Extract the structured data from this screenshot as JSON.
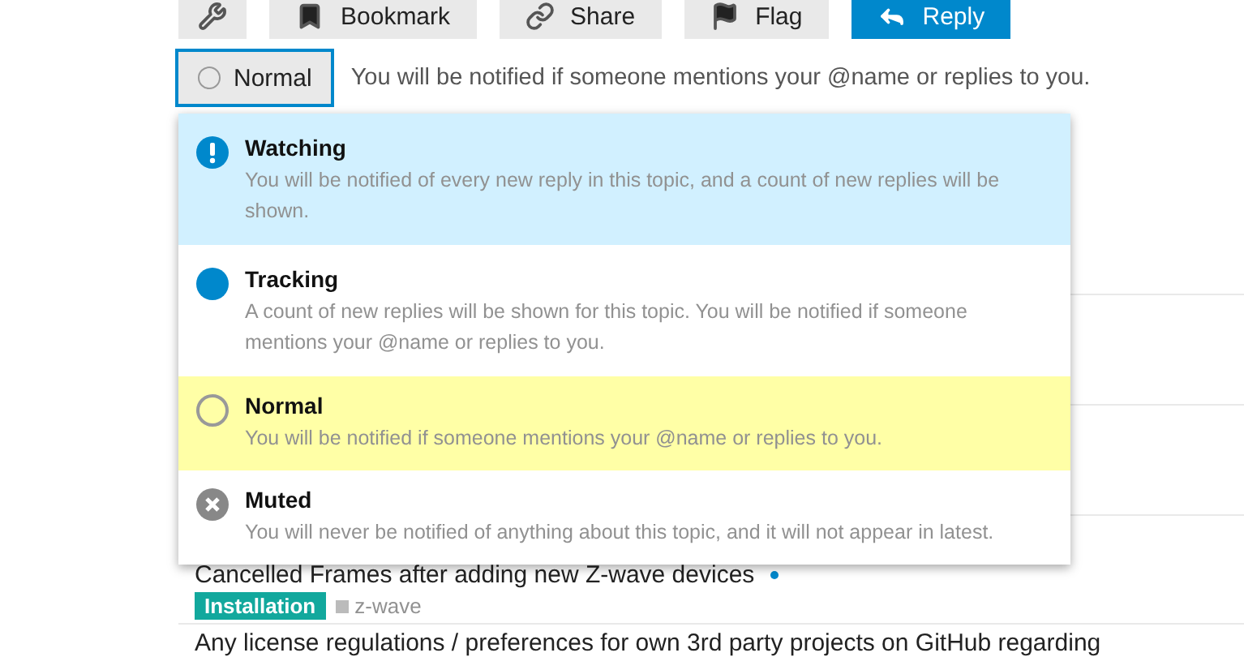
{
  "toolbar": [
    {
      "kind": "wrench"
    },
    {
      "kind": "bookmark",
      "label": "Bookmark"
    },
    {
      "kind": "share",
      "label": "Share"
    },
    {
      "kind": "flag",
      "label": "Flag"
    },
    {
      "kind": "reply",
      "label": "Reply",
      "primary": true
    }
  ],
  "notification": {
    "button": "Normal",
    "description": "You will be notified if someone mentions your @name or replies to you."
  },
  "levels": [
    {
      "kind": "watching",
      "title": "Watching",
      "description": "You will be notified of every new reply in this topic, and a count of new replies will be shown.",
      "selected": false,
      "hovered": true
    },
    {
      "kind": "tracking",
      "title": "Tracking",
      "description": "A count of new replies will be shown for this topic. You will be notified if someone mentions your @name or replies to you.",
      "selected": false,
      "hovered": false
    },
    {
      "kind": "normal",
      "title": "Normal",
      "description": "You will be notified if someone mentions your @name or replies to you.",
      "selected": true,
      "hovered": false
    },
    {
      "kind": "muted",
      "title": "Muted",
      "description": "You will never be notified of anything about this topic, and it will not appear in latest.",
      "selected": false,
      "hovered": false
    }
  ],
  "topics": [
    {
      "title": "Cancelled Frames after adding new Z-wave devices",
      "unread": true,
      "category": {
        "name": "Installation",
        "color": "#12a89d"
      },
      "tags": [
        "z-wave"
      ]
    },
    {
      "title": "Any license regulations / preferences for own 3rd party projects on GitHub regarding",
      "unread": false
    }
  ]
}
